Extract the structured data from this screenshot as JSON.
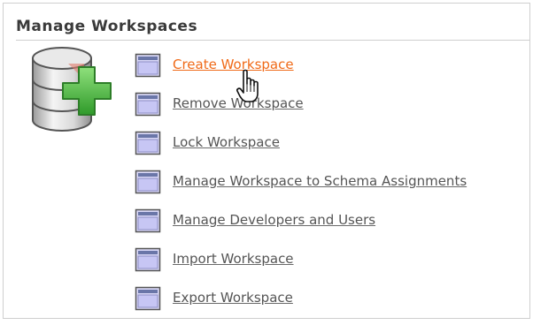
{
  "section": {
    "title": "Manage Workspaces",
    "icon": "database-add-icon"
  },
  "links": [
    {
      "label": "Create Workspace",
      "icon": "window-icon",
      "state": "hover"
    },
    {
      "label": "Remove Workspace",
      "icon": "window-icon",
      "state": "normal"
    },
    {
      "label": "Lock Workspace",
      "icon": "window-icon",
      "state": "normal"
    },
    {
      "label": "Manage Workspace to Schema Assignments",
      "icon": "window-icon",
      "state": "normal"
    },
    {
      "label": "Manage Developers and Users",
      "icon": "window-icon",
      "state": "normal"
    },
    {
      "label": "Import Workspace",
      "icon": "window-icon",
      "state": "normal"
    },
    {
      "label": "Export Workspace",
      "icon": "window-icon",
      "state": "normal"
    }
  ],
  "colors": {
    "link_normal": "#555555",
    "link_hover": "#f06a18",
    "border": "#cfcfcf",
    "icon_fill": "#c7c6f4",
    "plus_green": "#52b848"
  },
  "cursor": "hand-pointer-icon"
}
